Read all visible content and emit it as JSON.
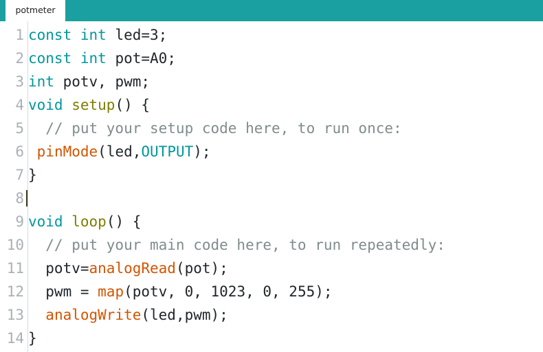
{
  "window": {
    "accent_color": "#1AA0A0",
    "background_color": "#FFFFFF"
  },
  "tabbar": {
    "tabs": [
      {
        "label": "potmeter",
        "active": true
      }
    ]
  },
  "editor": {
    "caret_line": 8,
    "caret_column": 0,
    "colors": {
      "keyword": "#00979C",
      "function_name": "#7E7E00",
      "library_function": "#D35400",
      "comment": "#7F8C8D",
      "plain_text": "#20252A",
      "line_number": "#A9B0B5",
      "gutter_rule": "#D5D9DC"
    },
    "lines": [
      {
        "number": "1",
        "tokens": [
          {
            "t": "const",
            "c": "kw"
          },
          {
            "t": " ",
            "c": "plain"
          },
          {
            "t": "int",
            "c": "kw"
          },
          {
            "t": " led=3;",
            "c": "plain"
          }
        ]
      },
      {
        "number": "2",
        "tokens": [
          {
            "t": "const",
            "c": "kw"
          },
          {
            "t": " ",
            "c": "plain"
          },
          {
            "t": "int",
            "c": "kw"
          },
          {
            "t": " pot=A0;",
            "c": "plain"
          }
        ]
      },
      {
        "number": "3",
        "tokens": [
          {
            "t": "int",
            "c": "kw"
          },
          {
            "t": " potv, pwm;",
            "c": "plain"
          }
        ]
      },
      {
        "number": "4",
        "tokens": [
          {
            "t": "void",
            "c": "kw"
          },
          {
            "t": " ",
            "c": "plain"
          },
          {
            "t": "setup",
            "c": "fn"
          },
          {
            "t": "() {",
            "c": "plain"
          }
        ]
      },
      {
        "number": "5",
        "tokens": [
          {
            "t": "  // put your setup code here, to run once:",
            "c": "cmt"
          }
        ]
      },
      {
        "number": "6",
        "tokens": [
          {
            "t": " ",
            "c": "plain"
          },
          {
            "t": "pinMode",
            "c": "lib"
          },
          {
            "t": "(led,",
            "c": "plain"
          },
          {
            "t": "OUTPUT",
            "c": "kw"
          },
          {
            "t": ");",
            "c": "plain"
          }
        ]
      },
      {
        "number": "7",
        "tokens": [
          {
            "t": "}",
            "c": "plain"
          }
        ]
      },
      {
        "number": "8",
        "tokens": [],
        "caret": true
      },
      {
        "number": "9",
        "tokens": [
          {
            "t": "void",
            "c": "kw"
          },
          {
            "t": " ",
            "c": "plain"
          },
          {
            "t": "loop",
            "c": "fn"
          },
          {
            "t": "() {",
            "c": "plain"
          }
        ]
      },
      {
        "number": "10",
        "tokens": [
          {
            "t": "  // put your main code here, to run repeatedly:",
            "c": "cmt"
          }
        ]
      },
      {
        "number": "11",
        "tokens": [
          {
            "t": "  potv=",
            "c": "plain"
          },
          {
            "t": "analogRead",
            "c": "lib"
          },
          {
            "t": "(pot);",
            "c": "plain"
          }
        ]
      },
      {
        "number": "12",
        "tokens": [
          {
            "t": "  pwm = ",
            "c": "plain"
          },
          {
            "t": "map",
            "c": "lib"
          },
          {
            "t": "(potv, 0, 1023, 0, 255);",
            "c": "plain"
          }
        ]
      },
      {
        "number": "13",
        "tokens": [
          {
            "t": "  ",
            "c": "plain"
          },
          {
            "t": "analogWrite",
            "c": "lib"
          },
          {
            "t": "(led,pwm);",
            "c": "plain"
          }
        ]
      },
      {
        "number": "14",
        "tokens": [
          {
            "t": "}",
            "c": "plain"
          }
        ]
      }
    ]
  }
}
